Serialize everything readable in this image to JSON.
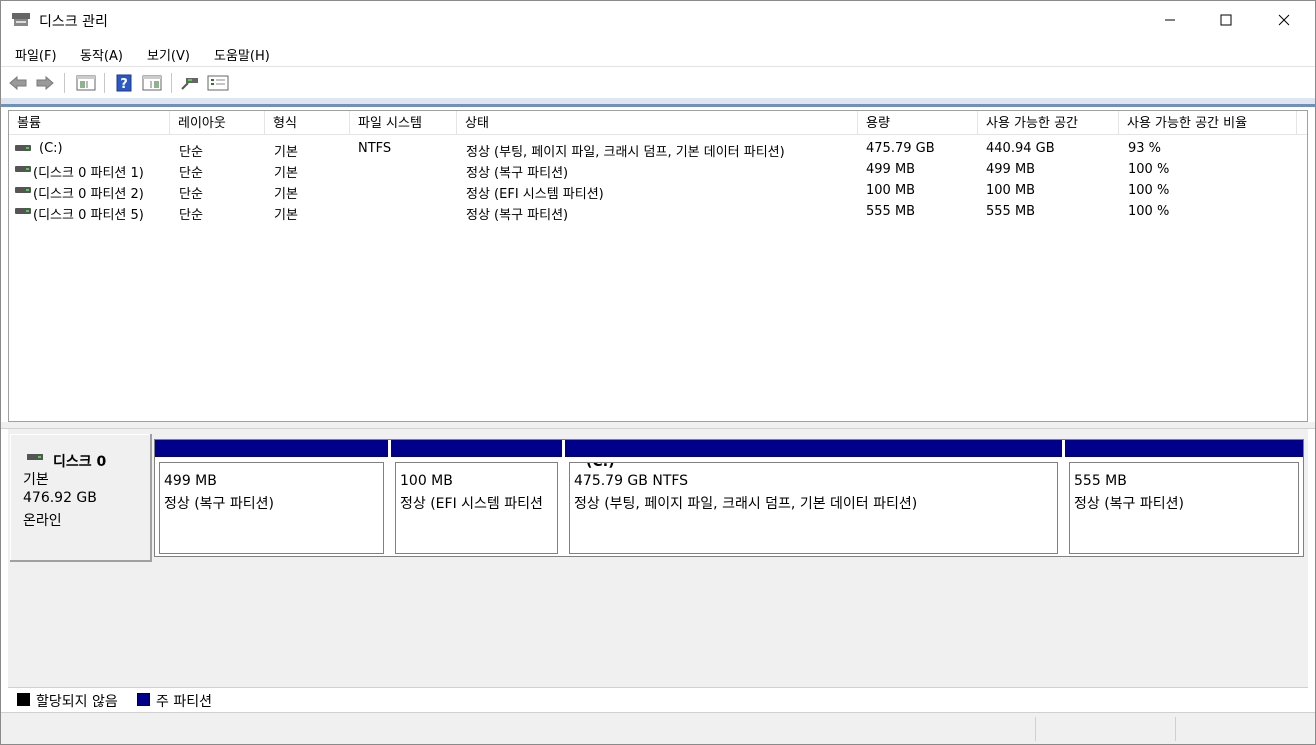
{
  "window": {
    "title": "디스크 관리",
    "minimize_icon": "minimize-icon",
    "maximize_icon": "maximize-icon",
    "close_icon": "close-icon"
  },
  "menu": [
    "파일(F)",
    "동작(A)",
    "보기(V)",
    "도움말(H)"
  ],
  "toolbar": [
    "back-arrow-icon",
    "forward-arrow-icon",
    "console-tree-icon",
    "help-icon",
    "action-pane-icon",
    "connect-icon",
    "properties-icon"
  ],
  "columns": [
    "볼륨",
    "레이아웃",
    "형식",
    "파일 시스템",
    "상태",
    "용량",
    "사용 가능한 공간",
    "사용 가능한 공간 비율"
  ],
  "volumes": [
    {
      "name": "(C:)",
      "layout": "단순",
      "type": "기본",
      "fs": "NTFS",
      "status": "정상 (부팅, 페이지 파일, 크래시 덤프, 기본 데이터 파티션)",
      "capacity": "475.79 GB",
      "free": "440.94 GB",
      "pct": "93 %"
    },
    {
      "name": "(디스크 0 파티션 1)",
      "layout": "단순",
      "type": "기본",
      "fs": "",
      "status": "정상 (복구 파티션)",
      "capacity": "499 MB",
      "free": "499 MB",
      "pct": "100 %"
    },
    {
      "name": "(디스크 0 파티션 2)",
      "layout": "단순",
      "type": "기본",
      "fs": "",
      "status": "정상 (EFI 시스템 파티션)",
      "capacity": "100 MB",
      "free": "100 MB",
      "pct": "100 %"
    },
    {
      "name": "(디스크 0 파티션 5)",
      "layout": "단순",
      "type": "기본",
      "fs": "",
      "status": "정상 (복구 파티션)",
      "capacity": "555 MB",
      "free": "555 MB",
      "pct": "100 %"
    }
  ],
  "disk": {
    "name": "디스크 0",
    "type": "기본",
    "size": "476.92 GB",
    "state": "온라인",
    "partitions": [
      {
        "label": "",
        "size": "499 MB",
        "status": "정상 (복구 파티션)"
      },
      {
        "label": "",
        "size": "100 MB",
        "status": "정상 (EFI 시스템 파티션"
      },
      {
        "label": "(C:)",
        "size": "475.79 GB NTFS",
        "status": "정상 (부팅, 페이지 파일, 크래시 덤프, 기본 데이터 파티션)"
      },
      {
        "label": "",
        "size": "555 MB",
        "status": "정상 (복구 파티션)"
      }
    ]
  },
  "legend": [
    {
      "label": "할당되지 않음",
      "color": "#000000"
    },
    {
      "label": "주 파티션",
      "color": "#00008b"
    }
  ]
}
